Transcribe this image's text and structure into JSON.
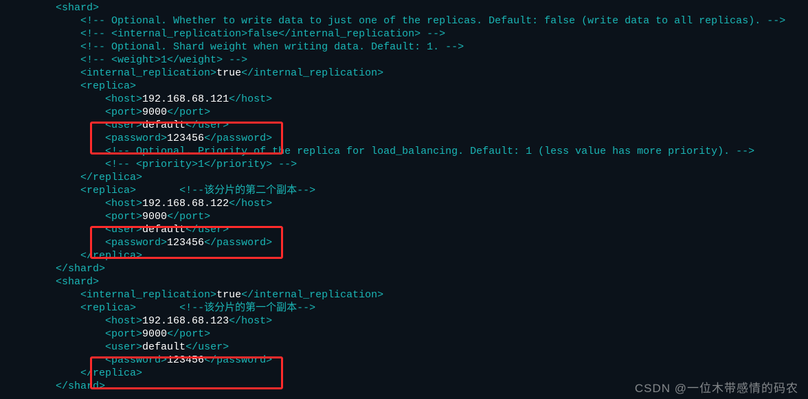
{
  "indent1": "         ",
  "indent2": "             ",
  "indent3": "                 ",
  "shard1": {
    "comment_replicas": "<!-- Optional. Whether to write data to just one of the replicas. Default: false (write data to all replicas). -->",
    "comment_internal": "<!-- <internal_replication>false</internal_replication> -->",
    "comment_weight_desc": "<!-- Optional. Shard weight when writing data. Default: 1. -->",
    "comment_weight_tag": "<!-- <weight>1</weight> -->",
    "internal_replication": "true",
    "replica1": {
      "host": "192.168.68.121",
      "port": "9000",
      "user": "default",
      "password": "123456",
      "comment_priority_desc": "<!-- Optional. Priority of the replica for load_balancing. Default: 1 (less value has more priority). -->",
      "comment_priority_tag": "<!-- <priority>1</priority> -->"
    },
    "replica2": {
      "comment_label": "<!--该分片的第二个副本-->",
      "host": "192.168.68.122",
      "port": "9000",
      "user": "default",
      "password": "123456"
    }
  },
  "shard2": {
    "internal_replication": "true",
    "replica1": {
      "comment_label": "<!--该分片的第一个副本-->",
      "host": "192.168.68.123",
      "port": "9000",
      "user": "default",
      "password": "123456"
    }
  },
  "watermark": "CSDN @一位木带感情的码农"
}
